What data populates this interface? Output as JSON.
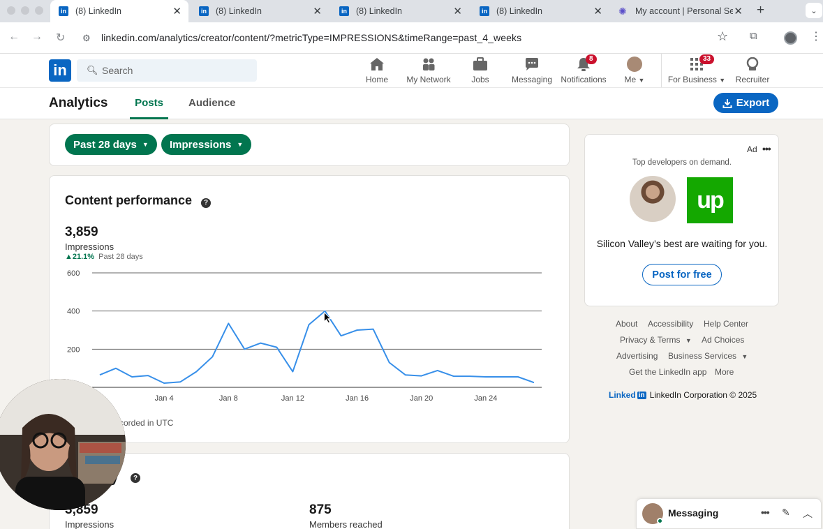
{
  "browser": {
    "tabs": [
      {
        "title": "(8) LinkedIn",
        "active": true
      },
      {
        "title": "(8) LinkedIn",
        "active": false
      },
      {
        "title": "(8) LinkedIn",
        "active": false
      },
      {
        "title": "(8) LinkedIn",
        "active": false
      },
      {
        "title": "My account | Personal Se",
        "active": false
      }
    ],
    "url": "linkedin.com/analytics/creator/content/?metricType=IMPRESSIONS&timeRange=past_4_weeks"
  },
  "header": {
    "logo": "in",
    "search_placeholder": "Search",
    "nav": [
      {
        "label": "Home",
        "icon": "home-icon"
      },
      {
        "label": "My Network",
        "icon": "network-icon"
      },
      {
        "label": "Jobs",
        "icon": "briefcase-icon"
      },
      {
        "label": "Messaging",
        "icon": "chat-icon"
      },
      {
        "label": "Notifications",
        "icon": "bell-icon",
        "badge": "8"
      },
      {
        "label": "Me",
        "icon": "avatar"
      },
      {
        "label": "For Business",
        "icon": "grid-icon",
        "badge": "33"
      },
      {
        "label": "Recruiter",
        "icon": "recruiter-icon"
      }
    ]
  },
  "subnav": {
    "title": "Analytics",
    "tabs": [
      "Posts",
      "Audience"
    ],
    "export_label": "Export"
  },
  "filters": {
    "time_range": "Past 28 days",
    "metric": "Impressions"
  },
  "performance": {
    "title": "Content performance",
    "total": "3,859",
    "metric_label": "Impressions",
    "change": "21.1%",
    "change_period": "Past 28 days",
    "utc_note": "corded in UTC"
  },
  "chart_data": {
    "type": "line",
    "x": [
      "Dec 31",
      "Jan 1",
      "Jan 2",
      "Jan 3",
      "Jan 4",
      "Jan 5",
      "Jan 6",
      "Jan 7",
      "Jan 8",
      "Jan 9",
      "Jan 10",
      "Jan 11",
      "Jan 12",
      "Jan 13",
      "Jan 14",
      "Jan 15",
      "Jan 16",
      "Jan 17",
      "Jan 18",
      "Jan 19",
      "Jan 20",
      "Jan 21",
      "Jan 22",
      "Jan 23",
      "Jan 24",
      "Jan 25",
      "Jan 26",
      "Jan 27"
    ],
    "values": [
      65,
      100,
      55,
      62,
      22,
      28,
      82,
      160,
      335,
      200,
      232,
      210,
      82,
      328,
      400,
      270,
      300,
      305,
      130,
      65,
      60,
      88,
      58,
      58,
      55,
      55,
      55,
      25
    ],
    "xtick_labels": [
      "31",
      "Jan 4",
      "Jan 8",
      "Jan 12",
      "Jan 16",
      "Jan 20",
      "Jan 24"
    ],
    "yticks": [
      "600",
      "400",
      "200"
    ],
    "ylim": [
      0,
      600
    ],
    "grid": true,
    "line_color": "#378fe9"
  },
  "summary": {
    "title_fragment": "y",
    "stats": [
      {
        "value": "3,859",
        "label": "Impressions"
      },
      {
        "value": "875",
        "label": "Members reached"
      }
    ]
  },
  "ad": {
    "label": "Ad",
    "subtitle": "Top developers on demand.",
    "brand_logo": "up",
    "headline": "Silicon Valley’s best are waiting for you.",
    "cta": "Post for free"
  },
  "footer": {
    "links": [
      "About",
      "Accessibility",
      "Help Center",
      "Privacy & Terms",
      "Ad Choices",
      "Advertising",
      "Business Services",
      "Get the LinkedIn app",
      "More"
    ],
    "brand": "Linked",
    "brand_box": "in",
    "copyright": "LinkedIn Corporation © 2025"
  },
  "messaging": {
    "label": "Messaging"
  }
}
